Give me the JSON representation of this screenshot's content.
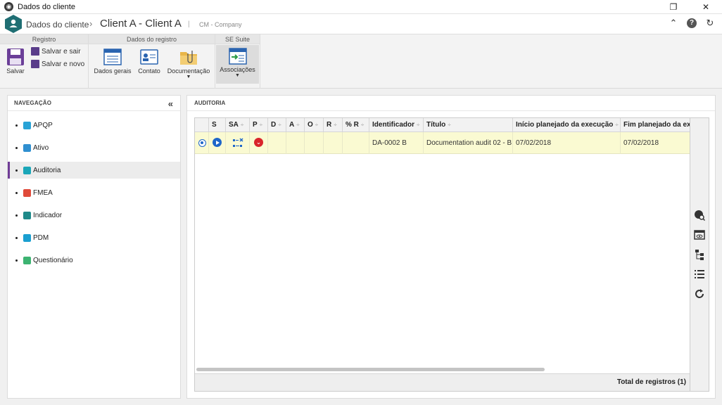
{
  "window": {
    "title": "Dados do cliente",
    "restore_glyph": "❐",
    "close_glyph": "✕"
  },
  "header": {
    "module_name": "Dados do cliente",
    "client_name": "Client A - Client A",
    "separator": "|",
    "company": "CM - Company",
    "icons": [
      "collapse-up-icon",
      "help-icon",
      "refresh-icon"
    ],
    "help_glyph": "?",
    "collapse_glyph": "⌃",
    "refresh_glyph": "↻"
  },
  "ribbon": {
    "groups": [
      {
        "title": "Registro",
        "buttons": [
          "Salvar",
          "Salvar e sair",
          "Salvar e novo"
        ]
      },
      {
        "title": "Dados do registro",
        "buttons": [
          "Dados gerais",
          "Contato",
          "Documentação"
        ]
      },
      {
        "title": "SE Suite",
        "buttons": [
          "Associações"
        ]
      }
    ]
  },
  "navigation": {
    "title": "NAVEGAÇÃO",
    "collapse_glyph": "«",
    "items": [
      {
        "label": "APQP",
        "color": "#29a3d6"
      },
      {
        "label": "Ativo",
        "color": "#2f8fd0"
      },
      {
        "label": "Auditoria",
        "color": "#1aa6b8",
        "active": true
      },
      {
        "label": "FMEA",
        "color": "#e04a3a"
      },
      {
        "label": "Indicador",
        "color": "#1f8a8a"
      },
      {
        "label": "PDM",
        "color": "#1a9fd0"
      },
      {
        "label": "Questionário",
        "color": "#3cb371"
      }
    ]
  },
  "main": {
    "title": "AUDITORIA",
    "sort_glyph": "÷",
    "columns": [
      "S",
      "SA",
      "P",
      "D",
      "A",
      "O",
      "R",
      "% R",
      "Identificador",
      "Título",
      "Início planejado da execução",
      "Fim planejado da execução"
    ],
    "rows": [
      {
        "selected": true,
        "status_icon": "play-icon",
        "sa_icon": "workflow-icon",
        "p_icon": "priority-down-icon",
        "p_glyph": "⌄",
        "d": "",
        "a": "",
        "o": "",
        "r": "",
        "pct_r": "",
        "identificador": "DA-0002 B",
        "titulo": "Documentation audit 02 - B",
        "inicio": "07/02/2018",
        "fim": "07/02/2018"
      }
    ],
    "total": "Total de registros (1)",
    "side_tools": [
      "view-search-icon",
      "preview-icon",
      "tree-icon",
      "list-icon",
      "refresh-icon"
    ]
  },
  "colors": {
    "accent": "#6f3c96",
    "brand_hex": "#1f6e73",
    "selected_row": "#fafad2"
  }
}
